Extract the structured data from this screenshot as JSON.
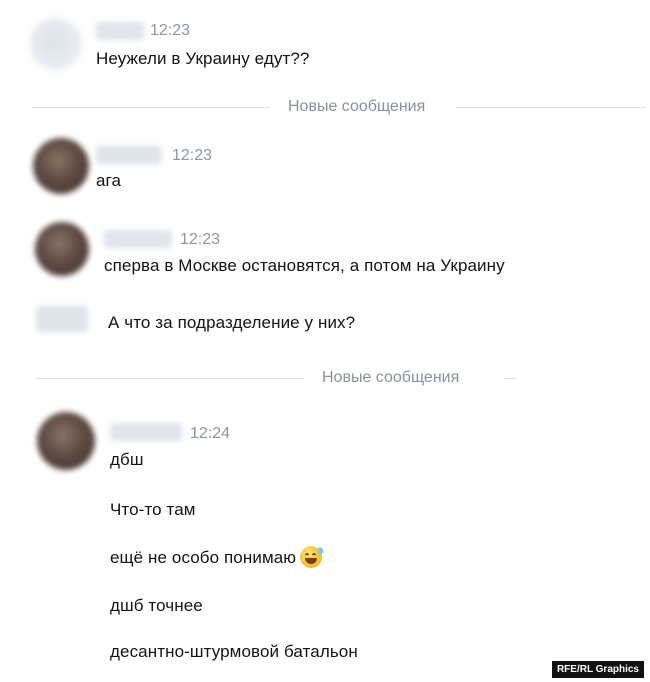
{
  "chat": {
    "messages": [
      {
        "time": "12:23",
        "lines": [
          "Неужели в Украину едут??"
        ]
      },
      {
        "time": "12:23",
        "lines": [
          "ага"
        ]
      },
      {
        "time": "12:23",
        "lines": [
          "сперва в Москве остановятся, а потом на Украину",
          "А что за подразделение у них?"
        ]
      },
      {
        "time": "12:24",
        "lines": [
          "дбш",
          "Что-то там",
          "ещё не особо понимаю",
          "дшб точнее",
          "десантно-штурмовой батальон"
        ]
      }
    ],
    "dividers": [
      "Новые сообщения",
      "Новые сообщения"
    ],
    "emoji_icon": "grinning-sweat-emoji"
  },
  "credit": "RFE/RL Graphics"
}
